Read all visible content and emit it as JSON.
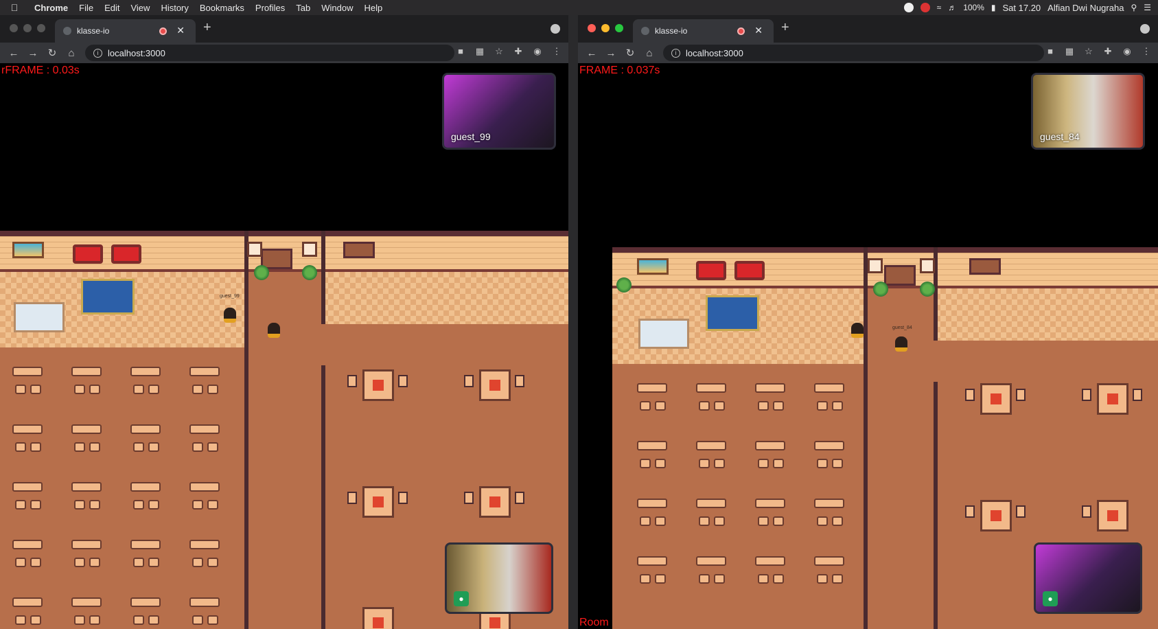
{
  "menubar": {
    "apple": "",
    "app": "Chrome",
    "items": [
      "File",
      "Edit",
      "View",
      "History",
      "Bookmarks",
      "Profiles",
      "Tab",
      "Window",
      "Help"
    ],
    "battery": "100%",
    "clock": "Sat 17.20",
    "user": "Alfian Dwi Nugraha"
  },
  "left": {
    "tab_title": "klasse-io",
    "url": "localhost:3000",
    "frame": "FRAME : 0.03s",
    "frame_prefix": "r",
    "remote_video_label": "guest_99",
    "map_name_tag": "guest_99"
  },
  "right": {
    "tab_title": "klasse-io",
    "url": "localhost:3000",
    "frame": "FRAME : 0.037s",
    "remote_video_label": "guest_84",
    "map_name_tag": "guest_84",
    "room_label": "Room"
  },
  "colors": {
    "frame_text": "#ff1a1a",
    "floor": "#b76f4b",
    "mic_button": "#1f9d55"
  },
  "icons": [
    "apple-icon",
    "info-icon",
    "camera-icon",
    "translate-icon",
    "star-icon",
    "extensions-icon",
    "profile-icon",
    "menu-icon",
    "mic-icon",
    "record-icon"
  ]
}
